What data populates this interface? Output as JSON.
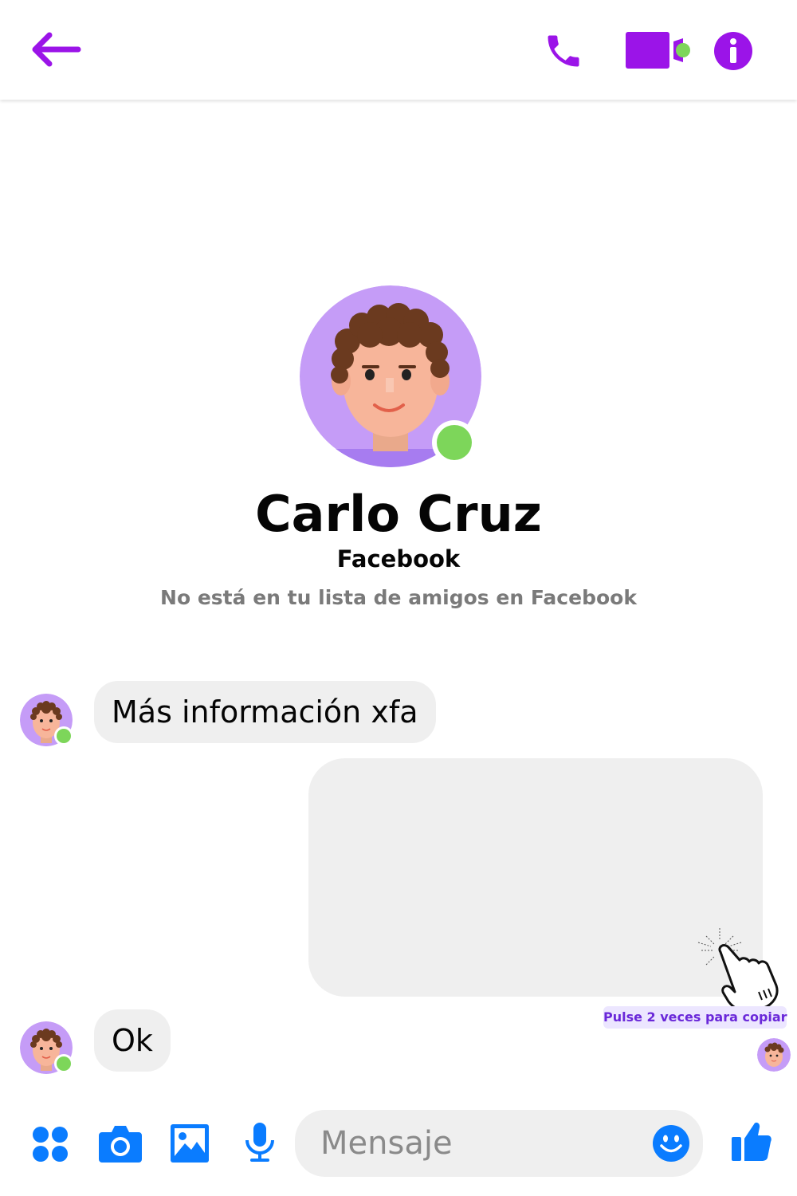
{
  "header": {
    "back_icon": "arrow-left-icon",
    "call_icon": "phone-icon",
    "video_icon": "video-camera-icon",
    "info_icon": "info-icon",
    "accent_color": "#9b14e8"
  },
  "profile": {
    "name": "Carlo Cruz",
    "source": "Facebook",
    "note": "No está en tu lista de amigos en Facebook",
    "online": true
  },
  "messages": [
    {
      "direction": "incoming",
      "text": "Más información xfa"
    },
    {
      "direction": "outgoing",
      "text": ""
    },
    {
      "direction": "incoming",
      "text": "Ok"
    }
  ],
  "copy_hint": "Pulse 2 veces para copiar",
  "composer": {
    "placeholder": "Mensaje",
    "icons": [
      "apps-icon",
      "camera-icon",
      "image-icon",
      "microphone-icon",
      "emoji-icon",
      "thumbs-up-icon"
    ],
    "icon_color": "#0a7cff"
  }
}
